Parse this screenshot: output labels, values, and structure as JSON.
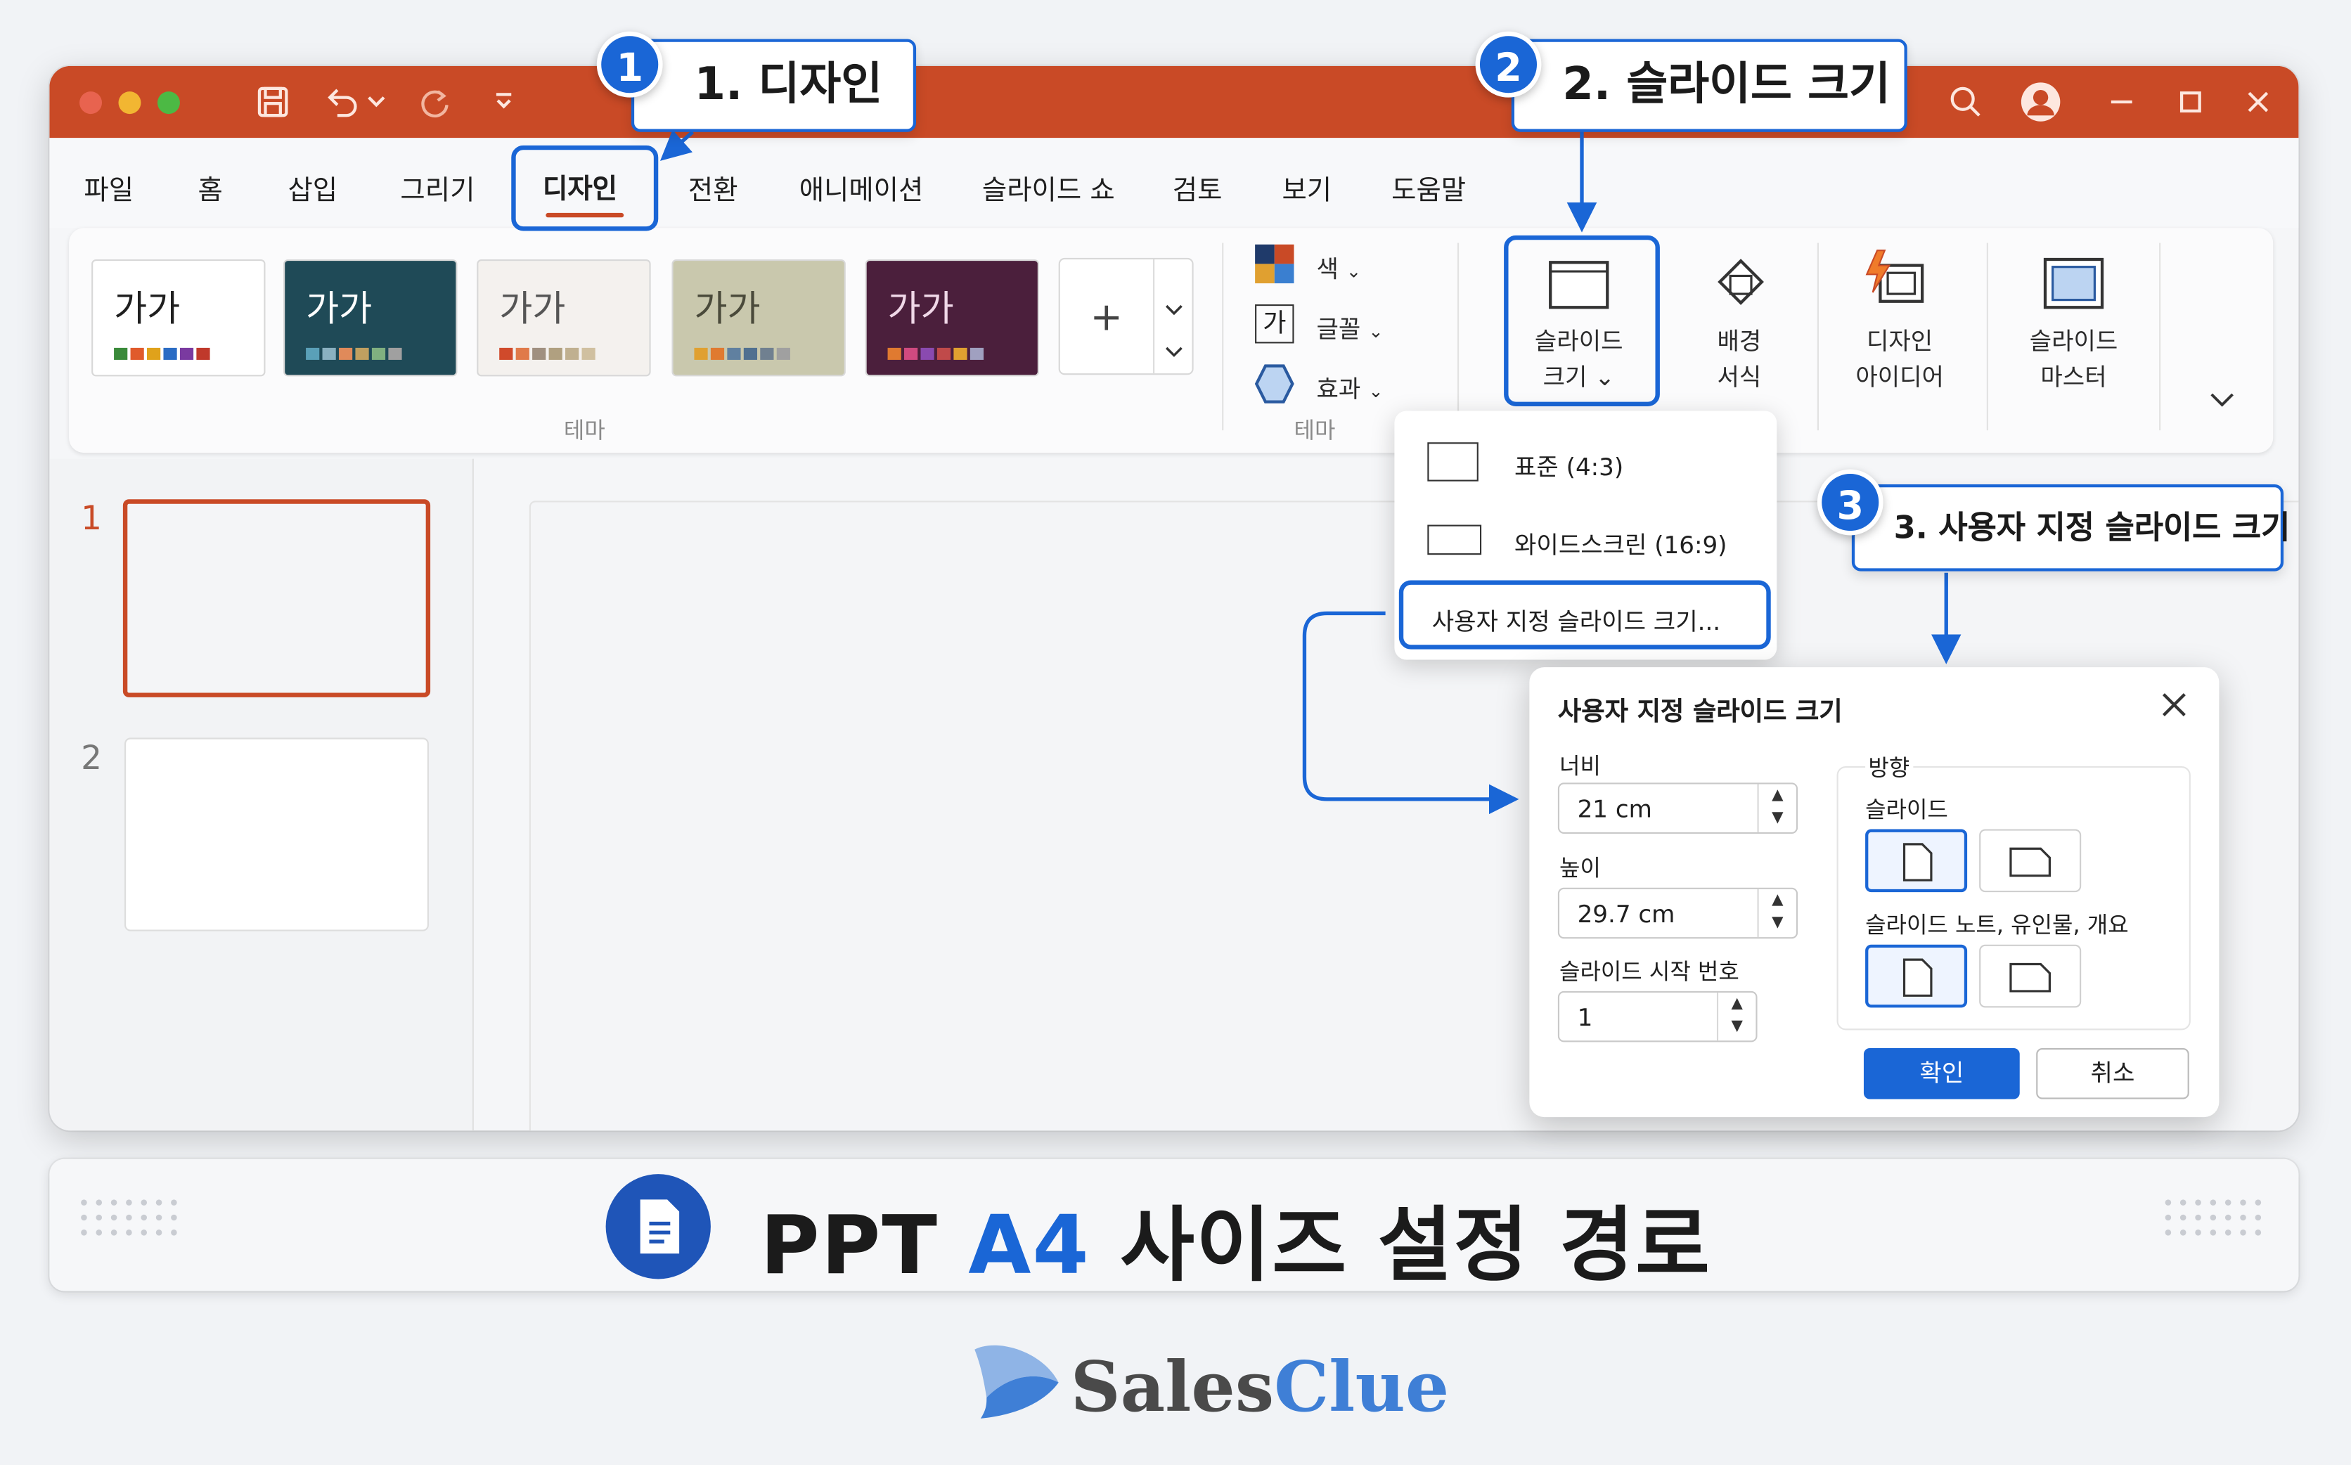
{
  "window": {
    "tabs": [
      "파일",
      "홈",
      "삽입",
      "그리기",
      "디자인",
      "전환",
      "애니메이션",
      "슬라이드 쇼",
      "검토",
      "보기",
      "도움말"
    ],
    "active_tab": "디자인"
  },
  "ribbon": {
    "themes": [
      {
        "label": "가가",
        "bg": "#ffffff",
        "fg": "#1f1f1f",
        "dots": [
          "#3a8a3a",
          "#e05a2b",
          "#e0a21b",
          "#2b6cc4",
          "#7a3aa0",
          "#c0392b"
        ]
      },
      {
        "label": "가가",
        "bg": "#1f4a57",
        "fg": "#ffffff",
        "dots": [
          "#5aa0b8",
          "#8ab0c0",
          "#e08a5a",
          "#c0a060",
          "#80b080",
          "#a0a0a0"
        ]
      },
      {
        "label": "가가",
        "bg": "#f4f1ee",
        "fg": "#555555",
        "dots": [
          "#d04a2b",
          "#e07a4a",
          "#a09080",
          "#b0a080",
          "#c0b090",
          "#d0c0a0"
        ]
      },
      {
        "label": "가가",
        "bg": "#c9c8ad",
        "fg": "#4a4a3a",
        "dots": [
          "#e0a030",
          "#e07a30",
          "#6080a0",
          "#507090",
          "#708090",
          "#a0a0a0"
        ]
      },
      {
        "label": "가가",
        "bg": "#4b1f3c",
        "fg": "#f0d8e8",
        "dots": [
          "#e07a30",
          "#d04a80",
          "#8a4ab0",
          "#c04a4a",
          "#e0a030",
          "#a0a0c0"
        ]
      }
    ],
    "group_theme": "테마",
    "group_variant": "테마",
    "variant_items": [
      {
        "icon": "color-palette-icon",
        "label": "색"
      },
      {
        "icon": "font-ga-icon",
        "label": "글꼴",
        "glyph": "가"
      },
      {
        "icon": "effects-hexagon-icon",
        "label": "효과"
      }
    ],
    "buttons": [
      {
        "line1": "슬라이드",
        "line2": "크기 ⌄"
      },
      {
        "line1": "배경",
        "line2": "서식"
      },
      {
        "line1": "디자인",
        "line2": "아이디어"
      },
      {
        "line1": "슬라이드",
        "line2": "마스터"
      }
    ],
    "add_symbol": "+"
  },
  "slides": {
    "numbers": [
      "1",
      "2"
    ]
  },
  "dropdown": {
    "items": [
      "표준 (4:3)",
      "와이드스크린 (16:9)",
      "사용자 지정 슬라이드 크기..."
    ]
  },
  "dialog": {
    "title": "사용자 지정 슬라이드 크기",
    "width_label": "너비",
    "width_value": "21 cm",
    "height_label": "높이",
    "height_value": "29.7 cm",
    "start_label": "슬라이드 시작 번호",
    "start_value": "1",
    "orientation_label": "방향",
    "slides_label": "슬라이드",
    "notes_label": "슬라이드 노트, 유인물, 개요",
    "ok": "확인",
    "cancel": "취소"
  },
  "callouts": [
    {
      "num": "1",
      "text": "1. 디자인"
    },
    {
      "num": "2",
      "text": "2. 슬라이드 크기"
    },
    {
      "num": "3",
      "text": "3. 사용자 지정 슬라이드 크기"
    }
  ],
  "banner": {
    "part1": "PPT ",
    "accent": "A4",
    "part2": " 사이즈 설정 경로",
    "accent_color": "#1a66d6"
  },
  "logo": {
    "part1": "Sales",
    "part2": "Clue",
    "color1": "#4a4a4a",
    "color2": "#3f7fd6"
  }
}
